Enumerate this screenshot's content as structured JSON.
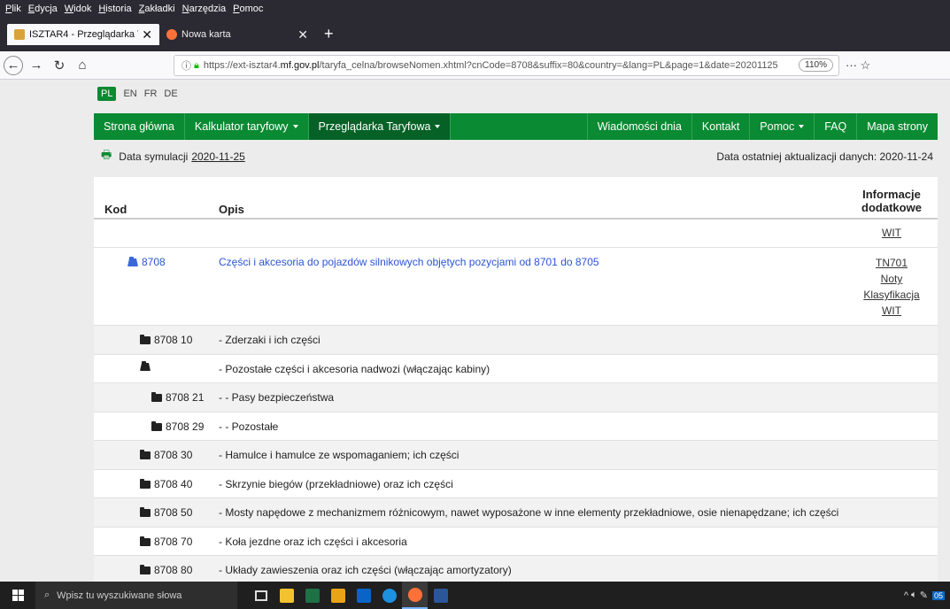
{
  "browser": {
    "menu": [
      "Plik",
      "Edycja",
      "Widok",
      "Historia",
      "Zakładki",
      "Narzędzia",
      "Pomoc"
    ],
    "tabs": [
      {
        "title": "ISZTAR4 - Przeglądarka Taryfow",
        "active": true,
        "close": "✕"
      },
      {
        "title": "Nowa karta",
        "active": false,
        "close": "✕"
      }
    ],
    "newtab": "+",
    "url_prefix": "https://ext-isztar4.",
    "url_domain": "mf.gov.pl",
    "url_rest": "/taryfa_celna/browseNomen.xhtml?cnCode=8708&suffix=80&country=&lang=PL&page=1&date=20201125",
    "zoom": "110%",
    "menu_dots": "···",
    "star": "☆"
  },
  "site": {
    "languages": [
      "PL",
      "EN",
      "FR",
      "DE"
    ],
    "nav": {
      "home": "Strona główna",
      "calculator": "Kalkulator taryfowy",
      "browser": "Przeglądarka Taryfowa",
      "news": "Wiadomości dnia",
      "contact": "Kontakt",
      "help": "Pomoc",
      "faq": "FAQ",
      "sitemap": "Mapa strony"
    },
    "sim_label": "Data symulacji",
    "sim_date": "2020-11-25",
    "update_label": "Data ostatniej aktualizacji danych: 2020-11-24"
  },
  "table": {
    "headers": {
      "code": "Kod",
      "desc": "Opis",
      "info1": "Informacje",
      "info2": "dodatkowe"
    },
    "partial_link": "WIT",
    "main_row": {
      "code": "8708",
      "desc": "Części i akcesoria do pojazdów silnikowych objętych pozycjami od 8701 do 8705",
      "links": [
        "TN701",
        "Noty",
        "Klasyfikacja",
        "WIT"
      ]
    },
    "rows": [
      {
        "code": "8708 10",
        "desc": "- Zderzaki i ich części"
      },
      {
        "code": "",
        "desc": "- Pozostałe części i akcesoria nadwozi (włączając kabiny)"
      },
      {
        "code": "8708 21",
        "desc": "- - Pasy bezpieczeństwa"
      },
      {
        "code": "8708 29",
        "desc": "- - Pozostałe"
      },
      {
        "code": "8708 30",
        "desc": "- Hamulce i hamulce ze wspomaganiem; ich części"
      },
      {
        "code": "8708 40",
        "desc": "- Skrzynie biegów (przekładniowe) oraz ich części"
      },
      {
        "code": "8708 50",
        "desc": "- Mosty napędowe z mechanizmem różnicowym, nawet wyposażone w inne elementy przekładniowe, osie nienapędzane; ich części"
      },
      {
        "code": "8708 70",
        "desc": "- Koła jezdne oraz ich części i akcesoria"
      },
      {
        "code": "8708 80",
        "desc": "- Układy zawieszenia oraz ich części (włączając amortyzatory)"
      }
    ]
  },
  "taskbar": {
    "search_placeholder": "Wpisz tu wyszukiwane słowa",
    "tray_badge": "05"
  }
}
